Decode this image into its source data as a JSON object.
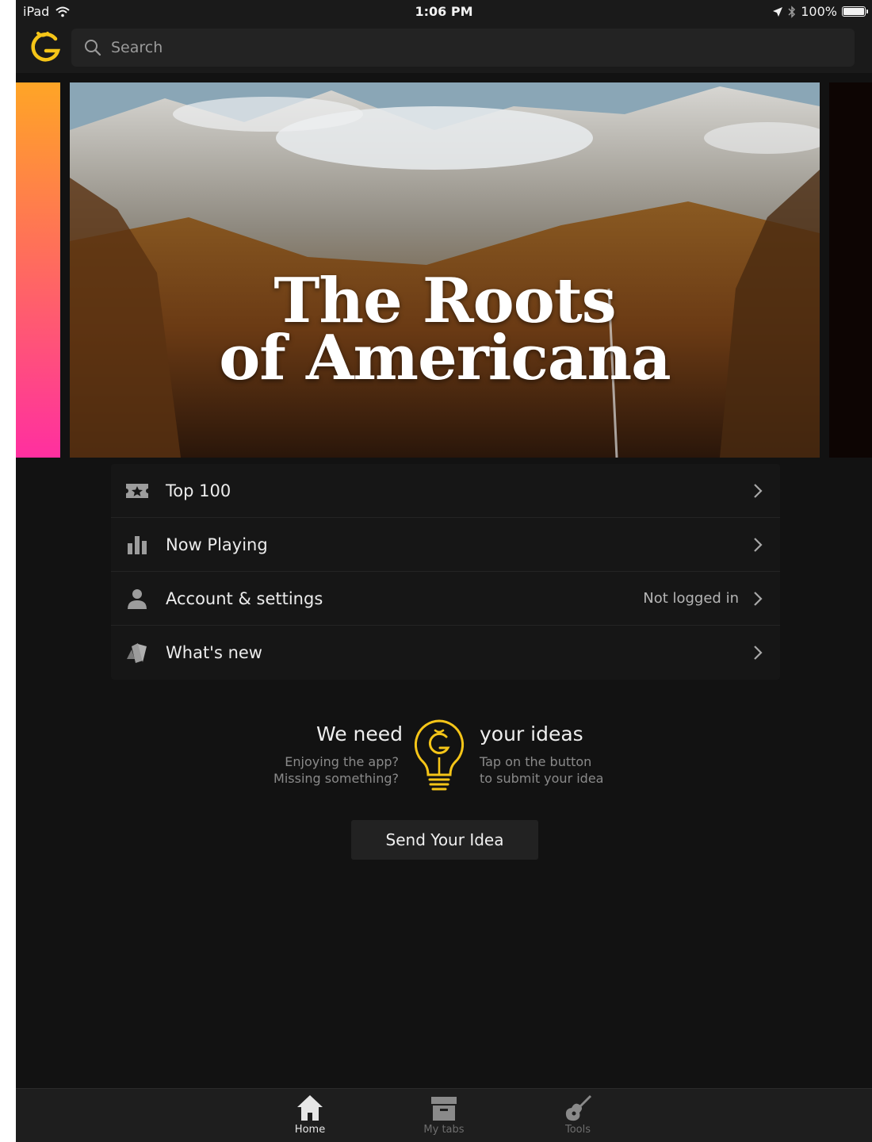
{
  "status_bar": {
    "device": "iPad",
    "time": "1:06 PM",
    "battery": "100%"
  },
  "search": {
    "placeholder": "Search"
  },
  "hero": {
    "title_line1": "The Roots",
    "title_line2": "of Americana"
  },
  "menu": {
    "items": [
      {
        "label": "Top 100",
        "icon": "ticket-star-icon",
        "value": ""
      },
      {
        "label": "Now Playing",
        "icon": "bar-chart-icon",
        "value": ""
      },
      {
        "label": "Account & settings",
        "icon": "person-icon",
        "value": "Not logged in"
      },
      {
        "label": "What's new",
        "icon": "cards-icon",
        "value": ""
      }
    ]
  },
  "ideas": {
    "title_left": "We need",
    "title_right": "your ideas",
    "sub_left_1": "Enjoying the app?",
    "sub_left_2": "Missing something?",
    "sub_right_1": "Tap on the button",
    "sub_right_2": "to submit your idea",
    "button_label": "Send Your Idea"
  },
  "tabs": [
    {
      "label": "Home",
      "icon": "home-icon",
      "active": true
    },
    {
      "label": "My tabs",
      "icon": "archive-box-icon",
      "active": false
    },
    {
      "label": "Tools",
      "icon": "guitar-icon",
      "active": false
    }
  ],
  "colors": {
    "background": "#121212",
    "accent_yellow": "#f5c518",
    "gradient_top": "#ffa526",
    "gradient_bottom": "#ff2fa0",
    "text_primary": "#ececec",
    "text_secondary": "#8a8a8a"
  }
}
